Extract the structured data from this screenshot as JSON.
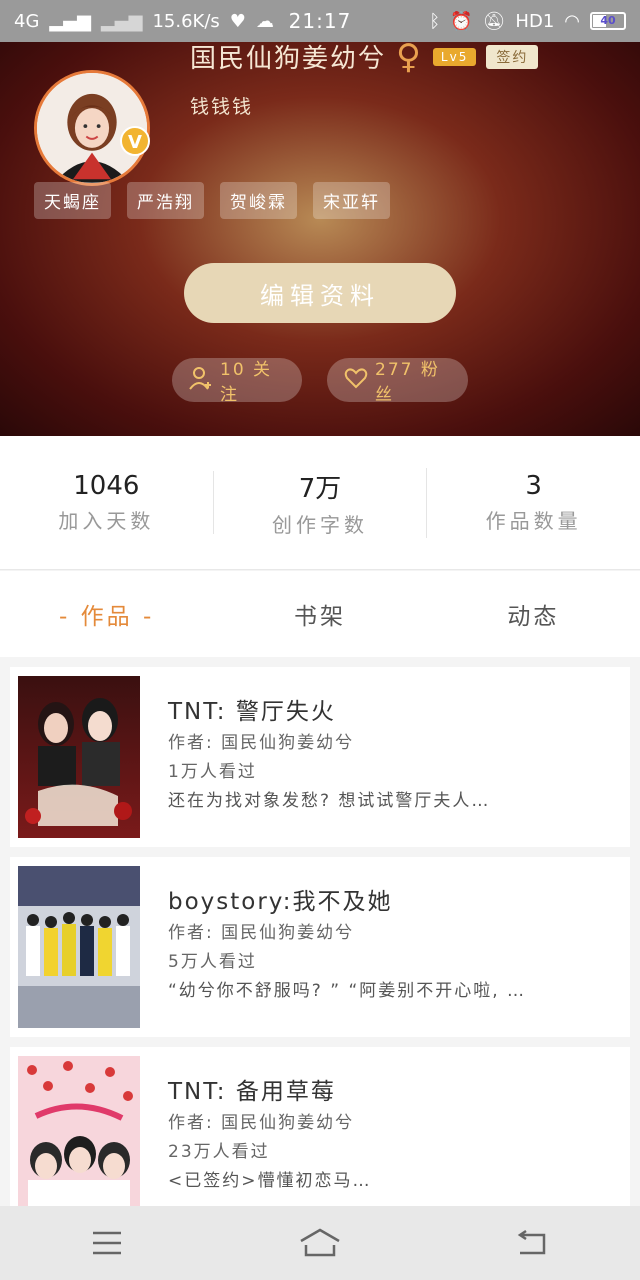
{
  "status_bar": {
    "network": "4G",
    "speed": "15.6K/s",
    "time": "21:17",
    "hd": "HD1",
    "battery": "40"
  },
  "profile": {
    "name": "国民仙狗姜幼兮",
    "gender_symbol": "♀",
    "level": "Lv5",
    "sign_badge": "签约",
    "subtitle": "钱钱钱",
    "v_badge": "V",
    "tags": [
      "天蝎座",
      "严浩翔",
      "贺峻霖",
      "宋亚轩"
    ],
    "edit_button": "编辑资料",
    "follow": "10 关注",
    "fans": "277 粉丝"
  },
  "stats": [
    {
      "value": "1046",
      "label": "加入天数"
    },
    {
      "value": "7万",
      "label": "创作字数"
    },
    {
      "value": "3",
      "label": "作品数量"
    }
  ],
  "tabs": [
    "- 作品 -",
    "书架",
    "动态"
  ],
  "works": [
    {
      "title": "TNT: 警厅失火",
      "author": "作者: 国民仙狗姜幼兮",
      "views": "1万人看过",
      "desc": "还在为找对象发愁? 想试试警厅夫人…"
    },
    {
      "title": "boystory:我不及她",
      "author": "作者: 国民仙狗姜幼兮",
      "views": "5万人看过",
      "desc": "“幼兮你不舒服吗? ” “阿姜别不开心啦, …"
    },
    {
      "title": "TNT: 备用草莓",
      "author": "作者: 国民仙狗姜幼兮",
      "views": "23万人看过",
      "desc": "<已签约>懵懂初恋马…"
    }
  ]
}
